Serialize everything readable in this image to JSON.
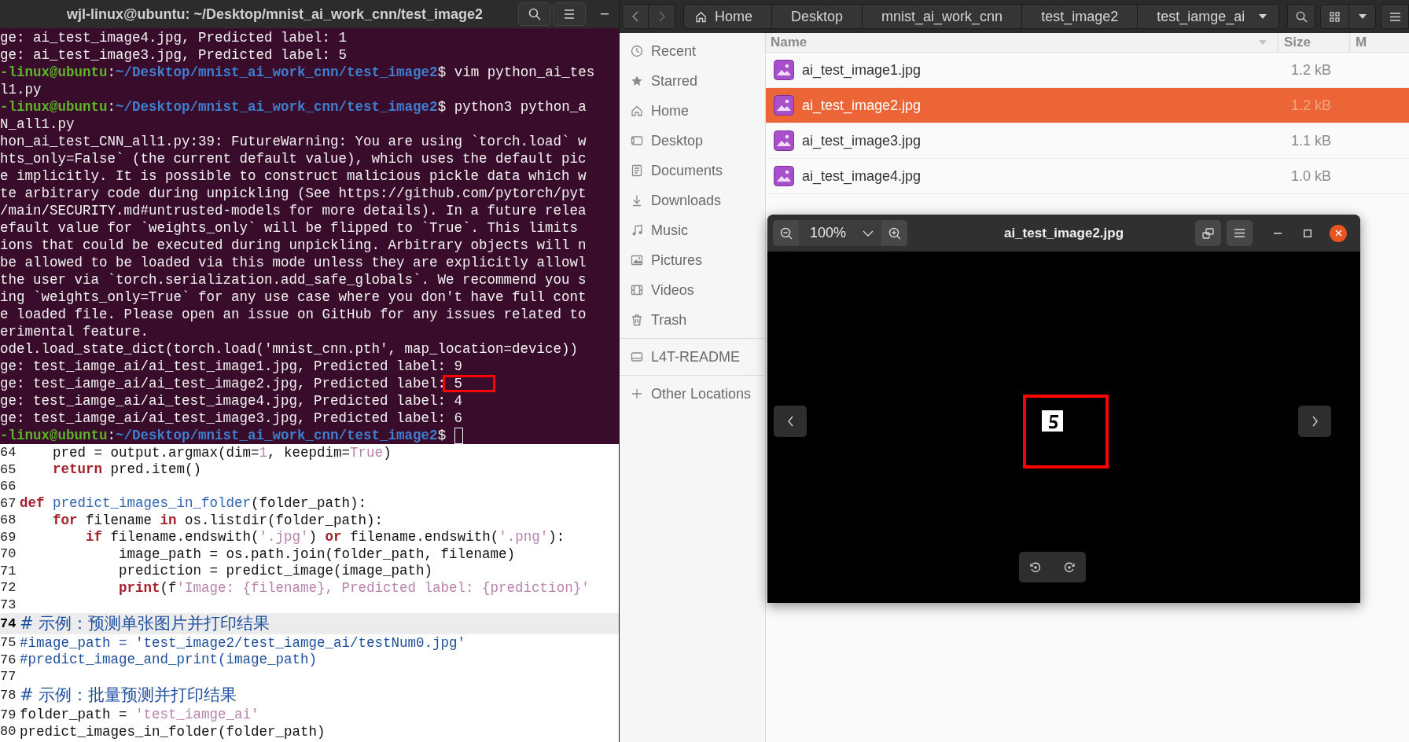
{
  "terminal": {
    "title": "wjl-linux@ubuntu: ~/Desktop/mnist_ai_work_cnn/test_image2",
    "lines": [
      {
        "kind": "output",
        "text": "ge: ai_test_image4.jpg, Predicted label: 1"
      },
      {
        "kind": "output",
        "text": "ge: ai_test_image3.jpg, Predicted label: 5"
      },
      {
        "kind": "prompt",
        "user": "-linux@ubuntu",
        "sep": ":",
        "path": "~/Desktop/mnist_ai_work_cnn/test_image2",
        "command": "$ vim python_ai_tes",
        "cursor": false
      },
      {
        "kind": "output",
        "text": "l1.py"
      },
      {
        "kind": "prompt",
        "user": "-linux@ubuntu",
        "sep": ":",
        "path": "~/Desktop/mnist_ai_work_cnn/test_image2",
        "command": "$ python3 python_a",
        "cursor": false
      },
      {
        "kind": "output",
        "text": "N_all1.py"
      },
      {
        "kind": "output",
        "text": "hon_ai_test_CNN_all1.py:39: FutureWarning: You are using `torch.load` w"
      },
      {
        "kind": "output",
        "text": "hts_only=False` (the current default value), which uses the default pic"
      },
      {
        "kind": "output",
        "text": "e implicitly. It is possible to construct malicious pickle data which w"
      },
      {
        "kind": "output",
        "text": "te arbitrary code during unpickling (See https://github.com/pytorch/pyt"
      },
      {
        "kind": "output",
        "text": "/main/SECURITY.md#untrusted-models for more details). In a future relea"
      },
      {
        "kind": "output",
        "text": "efault value for `weights_only` will be flipped to `True`. This limits"
      },
      {
        "kind": "output",
        "text": "ions that could be executed during unpickling. Arbitrary objects will n"
      },
      {
        "kind": "output",
        "text": "be allowed to be loaded via this mode unless they are explicitly allowl"
      },
      {
        "kind": "output",
        "text": "the user via `torch.serialization.add_safe_globals`. We recommend you s"
      },
      {
        "kind": "output",
        "text": "ing `weights_only=True` for any use case where you don't have full cont"
      },
      {
        "kind": "output",
        "text": "e loaded file. Please open an issue on GitHub for any issues related to"
      },
      {
        "kind": "output",
        "text": "erimental feature."
      },
      {
        "kind": "output",
        "text": "odel.load_state_dict(torch.load('mnist_cnn.pth', map_location=device))"
      },
      {
        "kind": "output",
        "text": "ge: test_iamge_ai/ai_test_image1.jpg, Predicted label: 9"
      },
      {
        "kind": "output",
        "text": "ge: test_iamge_ai/ai_test_image2.jpg, Predicted label: 5",
        "annotated": true
      },
      {
        "kind": "output",
        "text": "ge: test_iamge_ai/ai_test_image4.jpg, Predicted label: 4"
      },
      {
        "kind": "output",
        "text": "ge: test_iamge_ai/ai_test_image3.jpg, Predicted label: 6"
      },
      {
        "kind": "prompt",
        "user": "-linux@ubuntu",
        "sep": ":",
        "path": "~/Desktop/mnist_ai_work_cnn/test_image2",
        "command": "$",
        "cursor": true
      }
    ]
  },
  "editor": {
    "lines": [
      {
        "number": "64",
        "current": false,
        "kind": "code",
        "tokens": [
          {
            "kind": "plain",
            "text": "    pred = output.argmax(dim="
          },
          {
            "kind": "string",
            "text": "1"
          },
          {
            "kind": "plain",
            "text": ", keepdim="
          },
          {
            "kind": "string",
            "text": "True"
          },
          {
            "kind": "plain",
            "text": ")"
          }
        ]
      },
      {
        "number": "65",
        "current": false,
        "kind": "code",
        "tokens": [
          {
            "kind": "keyword",
            "text": "    return"
          },
          {
            "kind": "plain",
            "text": " pred.item()"
          }
        ]
      },
      {
        "number": "66",
        "current": false,
        "kind": "code"
      },
      {
        "number": "67",
        "current": false,
        "kind": "code",
        "tokens": [
          {
            "kind": "keyword",
            "text": "def"
          },
          {
            "kind": "name",
            "text": " predict_images_in_folder"
          },
          {
            "kind": "plain",
            "text": "(folder_path):"
          }
        ]
      },
      {
        "number": "68",
        "current": false,
        "kind": "code",
        "tokens": [
          {
            "kind": "keyword",
            "text": "    for"
          },
          {
            "kind": "plain",
            "text": " filename "
          },
          {
            "kind": "keyword",
            "text": "in"
          },
          {
            "kind": "plain",
            "text": " os.listdir(folder_path):"
          }
        ]
      },
      {
        "number": "69",
        "current": false,
        "kind": "code",
        "tokens": [
          {
            "kind": "keyword",
            "text": "        if"
          },
          {
            "kind": "plain",
            "text": " filename.endswith("
          },
          {
            "kind": "string",
            "text": "'.jpg'"
          },
          {
            "kind": "plain",
            "text": ") "
          },
          {
            "kind": "keyword",
            "text": "or"
          },
          {
            "kind": "plain",
            "text": " filename.endswith("
          },
          {
            "kind": "string",
            "text": "'.png'"
          },
          {
            "kind": "plain",
            "text": "):"
          }
        ]
      },
      {
        "number": "70",
        "current": false,
        "kind": "code",
        "tokens": [
          {
            "kind": "plain",
            "text": "            image_path = os.path.join(folder_path, filename)"
          }
        ]
      },
      {
        "number": "71",
        "current": false,
        "kind": "code",
        "tokens": [
          {
            "kind": "plain",
            "text": "            prediction = predict_image(image_path)"
          }
        ]
      },
      {
        "number": "72",
        "current": false,
        "kind": "code",
        "tokens": [
          {
            "kind": "keyword",
            "text": "            print"
          },
          {
            "kind": "plain",
            "text": "(f"
          },
          {
            "kind": "string",
            "text": "'Image: {filename}, Predicted label: {prediction}'"
          }
        ]
      },
      {
        "number": "73",
        "current": false,
        "kind": "code"
      },
      {
        "number": "74",
        "current": true,
        "kind": "note",
        "tokens": [
          {
            "kind": "comment",
            "text": "# 示例：预测单张图片并打印结果"
          }
        ]
      },
      {
        "number": "75",
        "current": false,
        "kind": "code",
        "tokens": [
          {
            "kind": "comment",
            "text": "#image_path = 'test_image2/test_iamge_ai/testNum0.jpg'"
          }
        ]
      },
      {
        "number": "76",
        "current": false,
        "kind": "code",
        "tokens": [
          {
            "kind": "comment",
            "text": "#predict_image_and_print(image_path)"
          }
        ]
      },
      {
        "number": "77",
        "current": false,
        "kind": "code"
      },
      {
        "number": "78",
        "current": false,
        "kind": "note",
        "tokens": [
          {
            "kind": "comment",
            "text": "# 示例：批量预测并打印结果"
          }
        ]
      },
      {
        "number": "79",
        "current": false,
        "kind": "code",
        "tokens": [
          {
            "kind": "plain",
            "text": "folder_path = "
          },
          {
            "kind": "string",
            "text": "'test_iamge_ai'"
          }
        ]
      },
      {
        "number": "80",
        "current": false,
        "kind": "code",
        "tokens": [
          {
            "kind": "plain",
            "text": "predict_images_in_folder(folder_path)"
          }
        ]
      }
    ]
  },
  "file_manager": {
    "path": [
      {
        "label": "Home",
        "kind": "home"
      },
      {
        "label": "Desktop",
        "kind": "plain"
      },
      {
        "label": "mnist_ai_work_cnn",
        "kind": "plain"
      },
      {
        "label": "test_image2",
        "kind": "plain"
      },
      {
        "label": "test_iamge_ai",
        "kind": "dropdown"
      }
    ],
    "sidebar": {
      "places": [
        "Recent",
        "Starred",
        "Home",
        "Desktop",
        "Documents",
        "Downloads",
        "Music",
        "Pictures",
        "Videos",
        "Trash"
      ],
      "devices": [
        "L4T-README"
      ],
      "other": [
        "Other Locations"
      ]
    },
    "columns": [
      "Name",
      "Size",
      "M"
    ],
    "files": [
      {
        "name": "ai_test_image1.jpg",
        "size": "1.2 kB",
        "selected": false
      },
      {
        "name": "ai_test_image2.jpg",
        "size": "1.2 kB",
        "selected": true
      },
      {
        "name": "ai_test_image3.jpg",
        "size": "1.1 kB",
        "selected": false
      },
      {
        "name": "ai_test_image4.jpg",
        "size": "1.0 kB",
        "selected": false
      }
    ]
  },
  "viewer": {
    "title": "ai_test_image2.jpg",
    "zoom": "100%"
  }
}
